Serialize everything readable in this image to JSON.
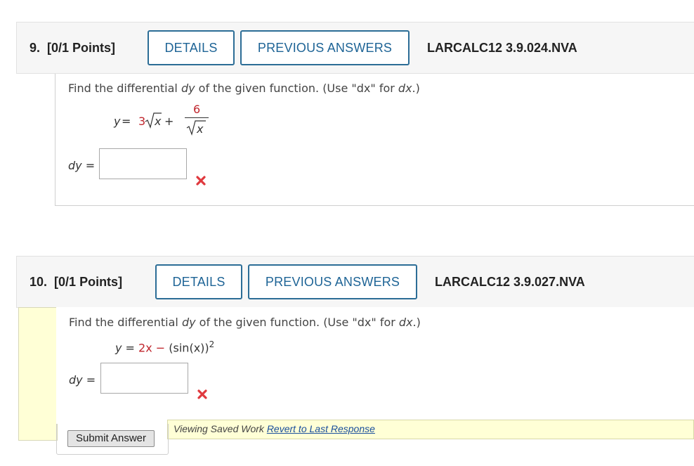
{
  "q9": {
    "number": "9.",
    "points": "[0/1 Points]",
    "details_label": "DETAILS",
    "previous_label": "PREVIOUS ANSWERS",
    "code": "LARCALC12 3.9.024.NVA",
    "prompt_a": "Find the differential ",
    "prompt_var": "dy",
    "prompt_b": " of the given function. (Use \"dx\" for ",
    "prompt_dx": "dx",
    "prompt_c": ".)",
    "eq_y": "y",
    "eq_eq": " = ",
    "eq_coef": "3",
    "eq_rad": "x",
    "eq_plus": " + ",
    "eq_num": "6",
    "eq_den": "x",
    "answer_label_var": "dy",
    "answer_label_eq": " =",
    "answer_value": "",
    "status": "incorrect"
  },
  "q10": {
    "number": "10.",
    "points": "[0/1 Points]",
    "details_label": "DETAILS",
    "previous_label": "PREVIOUS ANSWERS",
    "code": "LARCALC12 3.9.027.NVA",
    "prompt_a": "Find the differential ",
    "prompt_var": "dy",
    "prompt_b": " of the given function. (Use \"dx\" for ",
    "prompt_dx": "dx",
    "prompt_c": ".)",
    "eq_y": "y",
    "eq_eq": " = ",
    "eq_term1": "2x",
    "eq_minus": " − ",
    "eq_term2": "(sin(x))",
    "eq_exp": "2",
    "answer_label_var": "dy",
    "answer_label_eq": " =",
    "answer_value": "",
    "status": "incorrect",
    "submit_label": "Submit Answer",
    "viewing_text": "Viewing Saved Work ",
    "revert_link": "Revert to Last Response"
  },
  "colors": {
    "accent": "#2c6d96",
    "error": "#e0393e",
    "math_red": "#c0262d",
    "notice_bg": "#ffffd6"
  }
}
